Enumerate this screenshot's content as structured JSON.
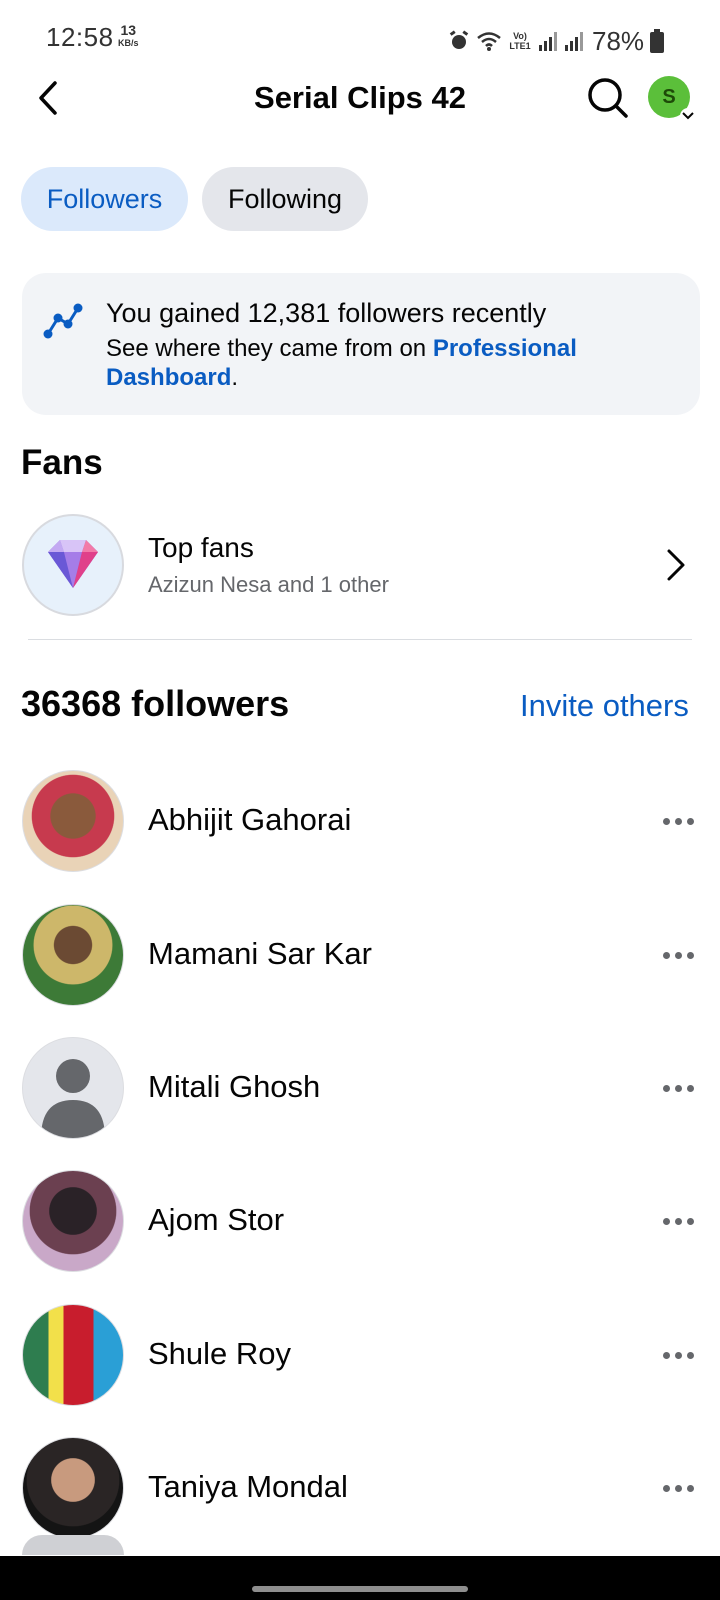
{
  "status_bar": {
    "time": "12:58",
    "speed_value": "13",
    "speed_unit": "KB/s",
    "network_label": "Vo) LTE1",
    "battery": "78%"
  },
  "header": {
    "title": "Serial Clips 42",
    "avatar_letter": "S"
  },
  "tabs": [
    {
      "label": "Followers",
      "active": true
    },
    {
      "label": "Following",
      "active": false
    }
  ],
  "gain_card": {
    "title": "You gained 12,381 followers recently",
    "sub_prefix": "See where they came from on ",
    "link": "Professional Dashboard",
    "sub_suffix": "."
  },
  "fans": {
    "heading": "Fans",
    "top_fans_title": "Top fans",
    "top_fans_sub": "Azizun Nesa and 1 other"
  },
  "followers": {
    "count_label": "36368 followers",
    "invite_label": "Invite others",
    "list": [
      {
        "name": "Abhijit Gahorai"
      },
      {
        "name": "Mamani Sar Kar"
      },
      {
        "name": "Mitali Ghosh"
      },
      {
        "name": "Ajom Stor"
      },
      {
        "name": "Shule Roy"
      },
      {
        "name": "Taniya Mondal"
      }
    ]
  },
  "colors": {
    "accent": "#0a5cc2",
    "active_tab_bg": "#dbe9fb",
    "inactive_tab_bg": "#e4e6eb",
    "card_bg": "#f2f4f7",
    "avatar_green": "#5bbf3a"
  }
}
